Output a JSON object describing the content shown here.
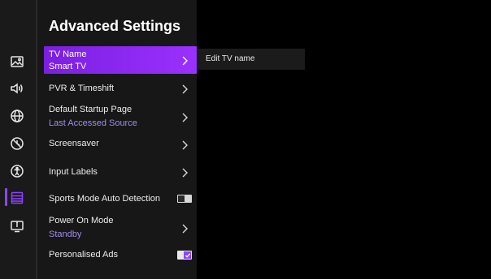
{
  "panel": {
    "title": "Advanced Settings"
  },
  "menu": {
    "tv_name": {
      "label": "TV Name",
      "value": "Smart TV"
    },
    "pvr": {
      "label": "PVR & Timeshift"
    },
    "startup": {
      "label": "Default Startup Page",
      "value": "Last Accessed Source"
    },
    "screensaver": {
      "label": "Screensaver"
    },
    "input_labels": {
      "label": "Input Labels"
    },
    "sports_mode": {
      "label": "Sports Mode Auto Detection",
      "enabled": false
    },
    "power_on": {
      "label": "Power On Mode",
      "value": "Standby"
    },
    "personalised_ads": {
      "label": "Personalised Ads",
      "checked": true
    }
  },
  "submenu": {
    "items": [
      "Edit TV name"
    ]
  },
  "rail_icons": [
    "picture-icon",
    "sound-icon",
    "network-icon",
    "timer-icon",
    "accessibility-icon",
    "settings-list-icon",
    "support-icon"
  ],
  "colors": {
    "accent": "#8e44ff",
    "subtext": "#a08ce8",
    "selected_gradient_start": "#7b1fe0",
    "selected_gradient_end": "#9b30ff"
  }
}
